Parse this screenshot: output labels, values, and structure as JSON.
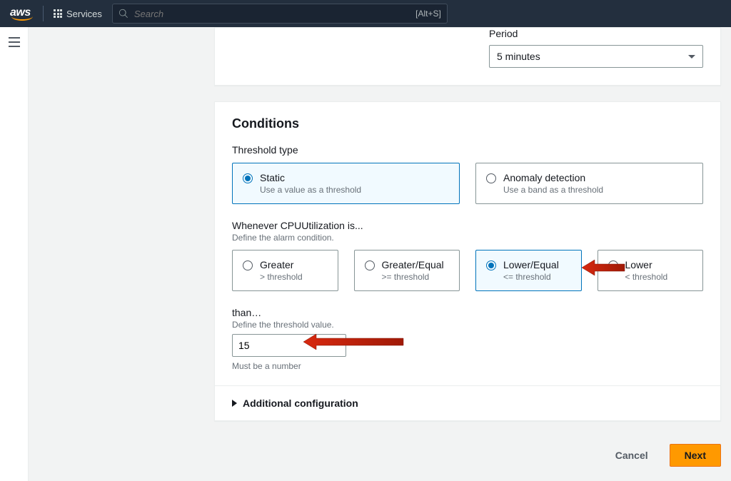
{
  "nav": {
    "logo_text": "aws",
    "services_label": "Services",
    "search_placeholder": "Search",
    "search_hint": "[Alt+S]"
  },
  "period": {
    "label": "Period",
    "value": "5 minutes"
  },
  "conditions": {
    "heading": "Conditions",
    "threshold_type_label": "Threshold type",
    "types": [
      {
        "title": "Static",
        "sub": "Use a value as a threshold",
        "selected": true
      },
      {
        "title": "Anomaly detection",
        "sub": "Use a band as a threshold",
        "selected": false
      }
    ],
    "whenever_label": "Whenever CPUUtilization is...",
    "whenever_help": "Define the alarm condition.",
    "ops": [
      {
        "title": "Greater",
        "sub": "> threshold",
        "selected": false
      },
      {
        "title": "Greater/Equal",
        "sub": ">= threshold",
        "selected": false
      },
      {
        "title": "Lower/Equal",
        "sub": "<= threshold",
        "selected": true
      },
      {
        "title": "Lower",
        "sub": "< threshold",
        "selected": false
      }
    ],
    "than_label": "than…",
    "than_help": "Define the threshold value.",
    "than_value": "15",
    "than_hint": "Must be a number",
    "additional_label": "Additional configuration"
  },
  "footer": {
    "cancel": "Cancel",
    "next": "Next"
  }
}
